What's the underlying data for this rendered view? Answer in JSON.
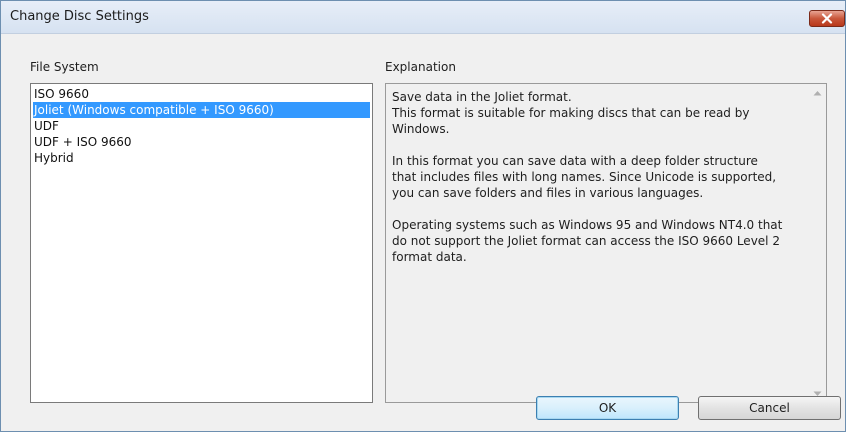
{
  "window": {
    "title": "Change Disc Settings",
    "close_icon": "close-icon"
  },
  "file_system": {
    "label": "File System",
    "selected_index": 1,
    "items": [
      {
        "label": "ISO 9660"
      },
      {
        "label": "Joliet (Windows compatible + ISO 9660)"
      },
      {
        "label": "UDF"
      },
      {
        "label": "UDF + ISO 9660"
      },
      {
        "label": "Hybrid"
      }
    ]
  },
  "explanation": {
    "label": "Explanation",
    "text": "Save data in the Joliet format.\nThis format is suitable for making discs that can be read by\nWindows.\n\nIn this format you can save data with a deep folder structure\nthat includes files with long names. Since Unicode is supported,\nyou can save folders and files in various languages.\n\nOperating systems such as Windows 95 and Windows NT4.0 that\ndo not support the Joliet format can access the ISO 9660 Level 2\nformat data."
  },
  "buttons": {
    "ok": "OK",
    "cancel": "Cancel"
  },
  "colors": {
    "selection": "#3399ff",
    "close_button": "#c9573b"
  }
}
